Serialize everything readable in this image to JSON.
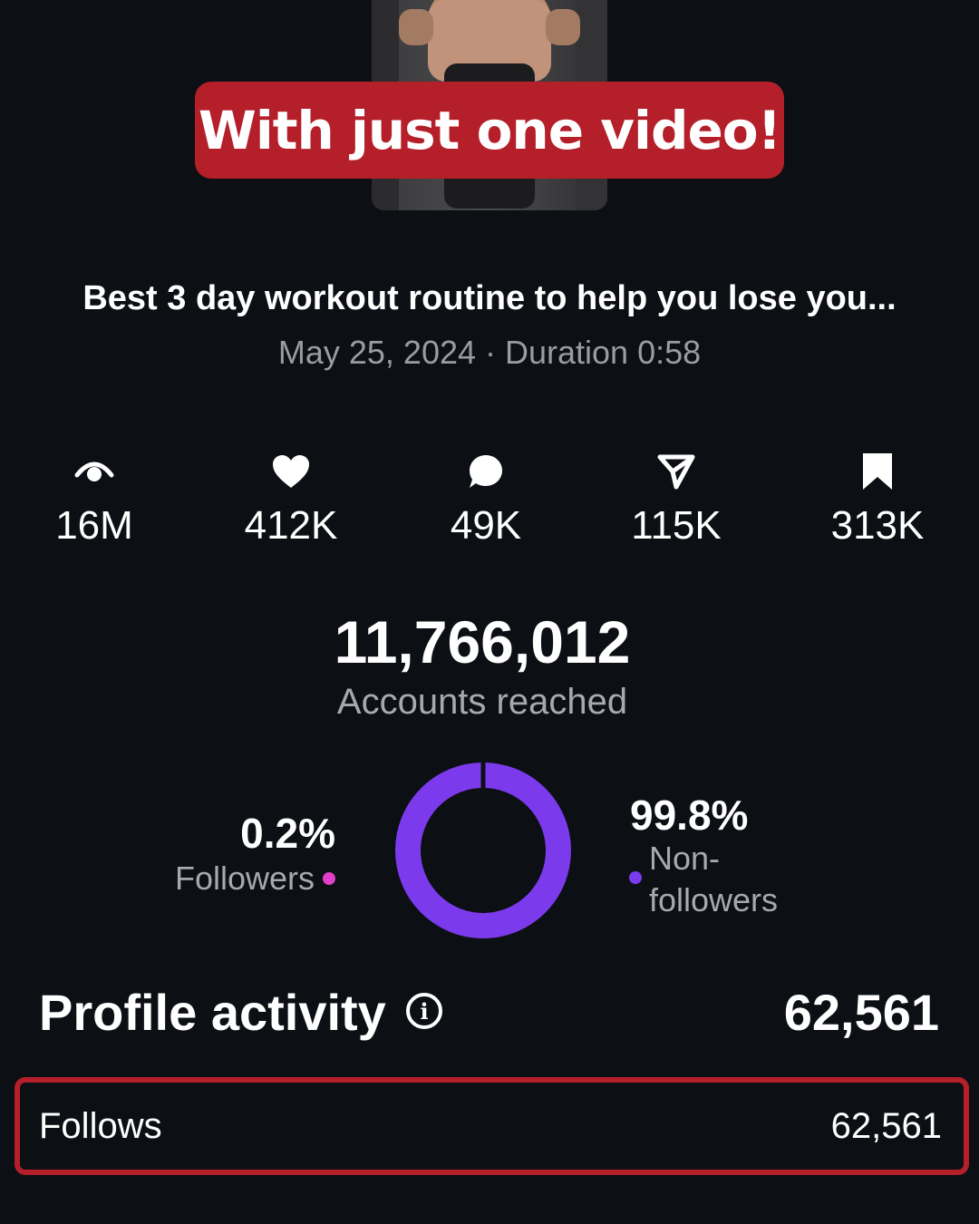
{
  "banner": {
    "text": "With just one video!"
  },
  "video": {
    "title": "Best 3 day workout routine to help you lose you...",
    "meta": "May 25, 2024 · Duration 0:58"
  },
  "stats": [
    {
      "icon": "eye-icon",
      "value": "16M"
    },
    {
      "icon": "heart-icon",
      "value": "412K"
    },
    {
      "icon": "comment-icon",
      "value": "49K"
    },
    {
      "icon": "share-icon",
      "value": "115K"
    },
    {
      "icon": "bookmark-icon",
      "value": "313K"
    }
  ],
  "reach": {
    "value": "11,766,012",
    "label": "Accounts reached"
  },
  "audience": {
    "followers_pct": "0.2%",
    "followers_label": "Followers",
    "followers_share": 0.2,
    "nonfollowers_pct": "99.8%",
    "nonfollowers_label": "Non-\nfollowers",
    "nonfollowers_share": 99.8,
    "colors": {
      "followers": "#e040c8",
      "nonfollowers": "#7c3aed"
    }
  },
  "profile_activity": {
    "title": "Profile activity",
    "value": "62,561",
    "rows": [
      {
        "label": "Follows",
        "value": "62,561"
      }
    ]
  },
  "colors": {
    "accent_red": "#b41f2a",
    "background": "#0c0f14"
  }
}
